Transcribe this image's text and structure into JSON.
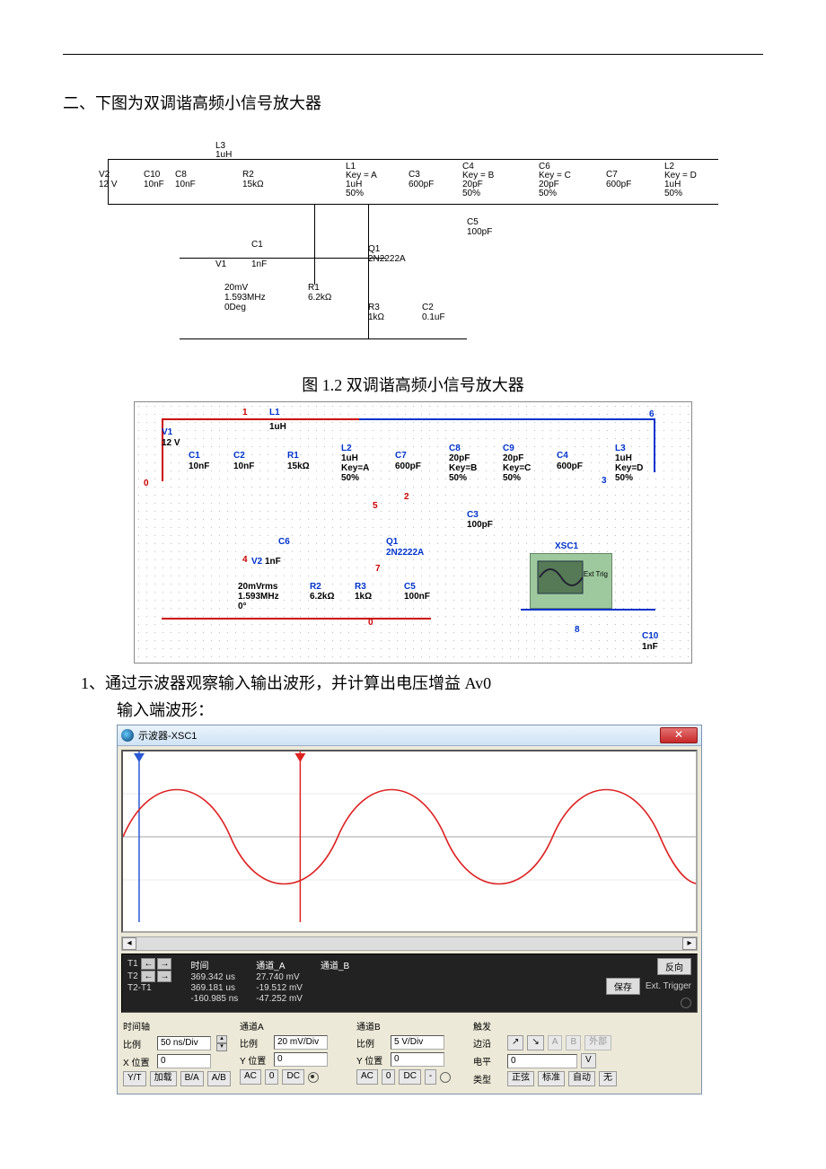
{
  "heading": "二、下图为双调谐高频小信号放大器",
  "caption1": "图 1.2   双调谐高频小信号放大器",
  "question1": "1、通过示波器观察输入输出波形，并计算出电压增益 Av0",
  "question1_sub": "输入端波形：",
  "schematic1": {
    "components": {
      "L3": {
        "name": "L3",
        "val": "1uH"
      },
      "V2": {
        "name": "V2",
        "val": "12 V"
      },
      "C10": {
        "name": "C10",
        "val": "10nF"
      },
      "C8": {
        "name": "C8",
        "val": "10nF"
      },
      "R2": {
        "name": "R2",
        "val": "15kΩ"
      },
      "L1": {
        "name": "L1",
        "val1": "Key = A",
        "val2": "1uH",
        "val3": "50%"
      },
      "C3": {
        "name": "C3",
        "val": "600pF"
      },
      "C4": {
        "name": "C4",
        "val1": "Key = B",
        "val2": "20pF",
        "val3": "50%"
      },
      "C5": {
        "name": "C5",
        "val": "100pF"
      },
      "C6": {
        "name": "C6",
        "val1": "Key = C",
        "val2": "20pF",
        "val3": "50%"
      },
      "C7": {
        "name": "C7",
        "val": "600pF"
      },
      "L2": {
        "name": "L2",
        "val1": "Key = D",
        "val2": "1uH",
        "val3": "50%"
      },
      "C1": {
        "name": "C1",
        "val": "1nF"
      },
      "V1": {
        "name": "V1",
        "val1": "20mV",
        "val2": "1.593MHz",
        "val3": "0Deg"
      },
      "Q1": {
        "name": "Q1",
        "val": "2N2222A"
      },
      "R1": {
        "name": "R1",
        "val": "6.2kΩ"
      },
      "R3": {
        "name": "R3",
        "val": "1kΩ"
      },
      "C2": {
        "name": "C2",
        "val": "0.1uF"
      }
    }
  },
  "schematic2": {
    "components": {
      "L1": {
        "name": "L1",
        "val": "1uH"
      },
      "V1": {
        "name": "V1",
        "val": "12 V"
      },
      "C1": {
        "name": "C1",
        "val": "10nF"
      },
      "C2": {
        "name": "C2",
        "val": "10nF"
      },
      "R1": {
        "name": "R1",
        "val": "15kΩ"
      },
      "L2": {
        "name": "L2",
        "val1": "1uH",
        "val2": "Key=A",
        "val3": "50%"
      },
      "C7": {
        "name": "C7",
        "val": "600pF"
      },
      "C8": {
        "name": "C8",
        "val1": "20pF",
        "val2": "Key=B",
        "val3": "50%"
      },
      "C9": {
        "name": "C9",
        "val1": "20pF",
        "val2": "Key=C",
        "val3": "50%"
      },
      "C4": {
        "name": "C4",
        "val": "600pF"
      },
      "L3": {
        "name": "L3",
        "val1": "1uH",
        "val2": "Key=D",
        "val3": "50%"
      },
      "C3": {
        "name": "C3",
        "val": "100pF"
      },
      "C6": {
        "name": "C6",
        "val": "1nF"
      },
      "V2": {
        "name": "V2",
        "val1": "20mVrms",
        "val2": "1.593MHz",
        "val3": "0°"
      },
      "Q1": {
        "name": "Q1",
        "val": "2N2222A"
      },
      "R2": {
        "name": "R2",
        "val": "6.2kΩ"
      },
      "R3": {
        "name": "R3",
        "val": "1kΩ"
      },
      "C5": {
        "name": "C5",
        "val": "100nF"
      },
      "XSC1": {
        "name": "XSC1",
        "label": "Ext Trig"
      },
      "C10": {
        "name": "C10",
        "val": "1nF"
      }
    },
    "nets": [
      "0",
      "1",
      "2",
      "3",
      "4",
      "5",
      "6",
      "7",
      "8"
    ]
  },
  "oscilloscope": {
    "title": "示波器-XSC1",
    "close": "✕",
    "readout": {
      "time_hdr": "时间",
      "chA_hdr": "通道_A",
      "chB_hdr": "通道_B",
      "T1_lab": "T1",
      "T2_lab": "T2",
      "dT_lab": "T2-T1",
      "T1_time": "369.342 us",
      "T2_time": "369.181 us",
      "dT_time": "-160.985 ns",
      "T1_A": "27.740 mV",
      "T2_A": "-19.512 mV",
      "dT_A": "-47.252 mV",
      "reverse": "反向",
      "save": "保存",
      "ext_trigger": "Ext. Trigger"
    },
    "panel": {
      "time": {
        "hdr": "时间轴",
        "scale_lab": "比例",
        "scale": "50 ns/Div",
        "xpos_lab": "X 位置",
        "xpos": "0",
        "btns": [
          "Y/T",
          "加载",
          "B/A",
          "A/B"
        ]
      },
      "chA": {
        "hdr": "通道A",
        "scale_lab": "比例",
        "scale": "20 mV/Div",
        "ypos_lab": "Y 位置",
        "ypos": "0",
        "btns": [
          "AC",
          "0",
          "DC"
        ]
      },
      "chB": {
        "hdr": "通道B",
        "scale_lab": "比例",
        "scale": "5 V/Div",
        "ypos_lab": "Y 位置",
        "ypos": "0",
        "btns": [
          "AC",
          "0",
          "DC",
          "-"
        ]
      },
      "trig": {
        "hdr": "触发",
        "edge_lab": "边沿",
        "edge_btns": [
          "↗",
          "↘",
          "A",
          "B",
          "外部"
        ],
        "level_lab": "电平",
        "level": "0",
        "level_unit": "V",
        "type_lab": "类型",
        "type_btns": [
          "正弦",
          "标准",
          "自动",
          "无"
        ]
      }
    }
  },
  "chart_data": {
    "type": "line",
    "title": "示波器-XSC1 输入端波形",
    "xlabel": "时间",
    "ylabel": "通道_A",
    "x_scale": "50 ns/Div",
    "y_scale": "20 mV/Div",
    "series": [
      {
        "name": "通道A (输入)",
        "color": "#d22",
        "waveform": "sine",
        "amplitude_mV": 28,
        "period_ns": 628,
        "phase_deg": 0,
        "sample_points_mV": [
          0,
          17.8,
          27.4,
          25.9,
          14.1,
          -4.6,
          -21.4,
          -28,
          -22.9,
          -8.7,
          9.5,
          24.2,
          27.9,
          20.8,
          4.6
        ]
      }
    ],
    "cursors": {
      "T1": "369.342 us",
      "T2": "369.181 us",
      "T2-T1": "-160.985 ns",
      "A@T1": "27.740 mV",
      "A@T2": "-19.512 mV",
      "ΔA": "-47.252 mV"
    },
    "ylim_mV": [
      -60,
      60
    ]
  }
}
